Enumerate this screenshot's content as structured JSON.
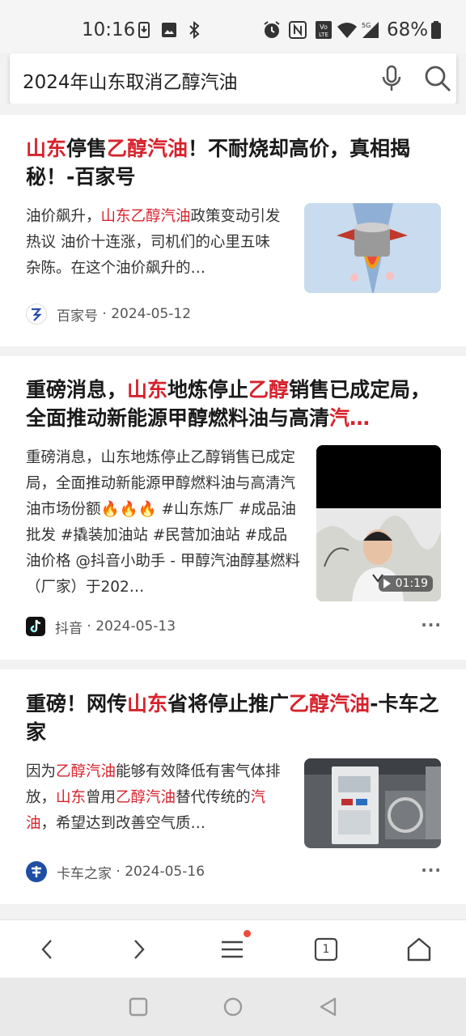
{
  "status_bar": {
    "time": "10:16",
    "battery_percent": "68%"
  },
  "search": {
    "query": "2024年山东取消乙醇汽油"
  },
  "results": [
    {
      "title_parts": [
        {
          "text": "山东",
          "hl": true
        },
        {
          "text": "停售",
          "hl": false
        },
        {
          "text": "乙醇汽油",
          "hl": true
        },
        {
          "text": "！不耐烧却高价，真相揭秘！-百家号",
          "hl": false
        }
      ],
      "snippet_parts": [
        {
          "text": "油价飙升，",
          "hl": false
        },
        {
          "text": "山东乙醇汽油",
          "hl": true
        },
        {
          "text": "政策变动引发热议 油价十连涨，司机们的心里五味杂陈。在这个油价飙升的…",
          "hl": false
        }
      ],
      "source": "百家号",
      "date": "2024-05-12"
    },
    {
      "title_parts": [
        {
          "text": "重磅消息，",
          "hl": false
        },
        {
          "text": "山东",
          "hl": true
        },
        {
          "text": "地炼停止",
          "hl": false
        },
        {
          "text": "乙醇",
          "hl": true
        },
        {
          "text": "销售已成定局，全面推动新能源甲醇燃料油与高清",
          "hl": false
        },
        {
          "text": "汽…",
          "hl": true
        }
      ],
      "snippet": "重磅消息，山东地炼停止乙醇销售已成定局，全面推动新能源甲醇燃料油与高清汽油市场份额🔥🔥🔥 #山东炼厂 #成品油批发 #撬装加油站 #民营加油站 #成品油价格 @抖音小助手 - 甲醇汽油醇基燃料（厂家）于202…",
      "video_duration": "01:19",
      "source": "抖音",
      "date": "2024-05-13",
      "more": "···"
    },
    {
      "title_parts": [
        {
          "text": "重磅！网传",
          "hl": false
        },
        {
          "text": "山东",
          "hl": true
        },
        {
          "text": "省将停止推广",
          "hl": false
        },
        {
          "text": "乙醇汽油",
          "hl": true
        },
        {
          "text": "-卡车之家",
          "hl": false
        }
      ],
      "snippet_parts": [
        {
          "text": "因为",
          "hl": false
        },
        {
          "text": "乙醇汽油",
          "hl": true
        },
        {
          "text": "能够有效降低有害气体排放，",
          "hl": false
        },
        {
          "text": "山东",
          "hl": true
        },
        {
          "text": "曾用",
          "hl": false
        },
        {
          "text": "乙醇汽油",
          "hl": true
        },
        {
          "text": "替代传统的",
          "hl": false
        },
        {
          "text": "汽油",
          "hl": true
        },
        {
          "text": "，希望达到改善空气质…",
          "hl": false
        }
      ],
      "source": "卡车之家",
      "date": "2024-05-16",
      "more": "···"
    }
  ],
  "toolbar": {
    "tab_count": "1",
    "colors": {
      "notification_dot": "#f04a3c",
      "highlight": "#d6232d"
    }
  }
}
